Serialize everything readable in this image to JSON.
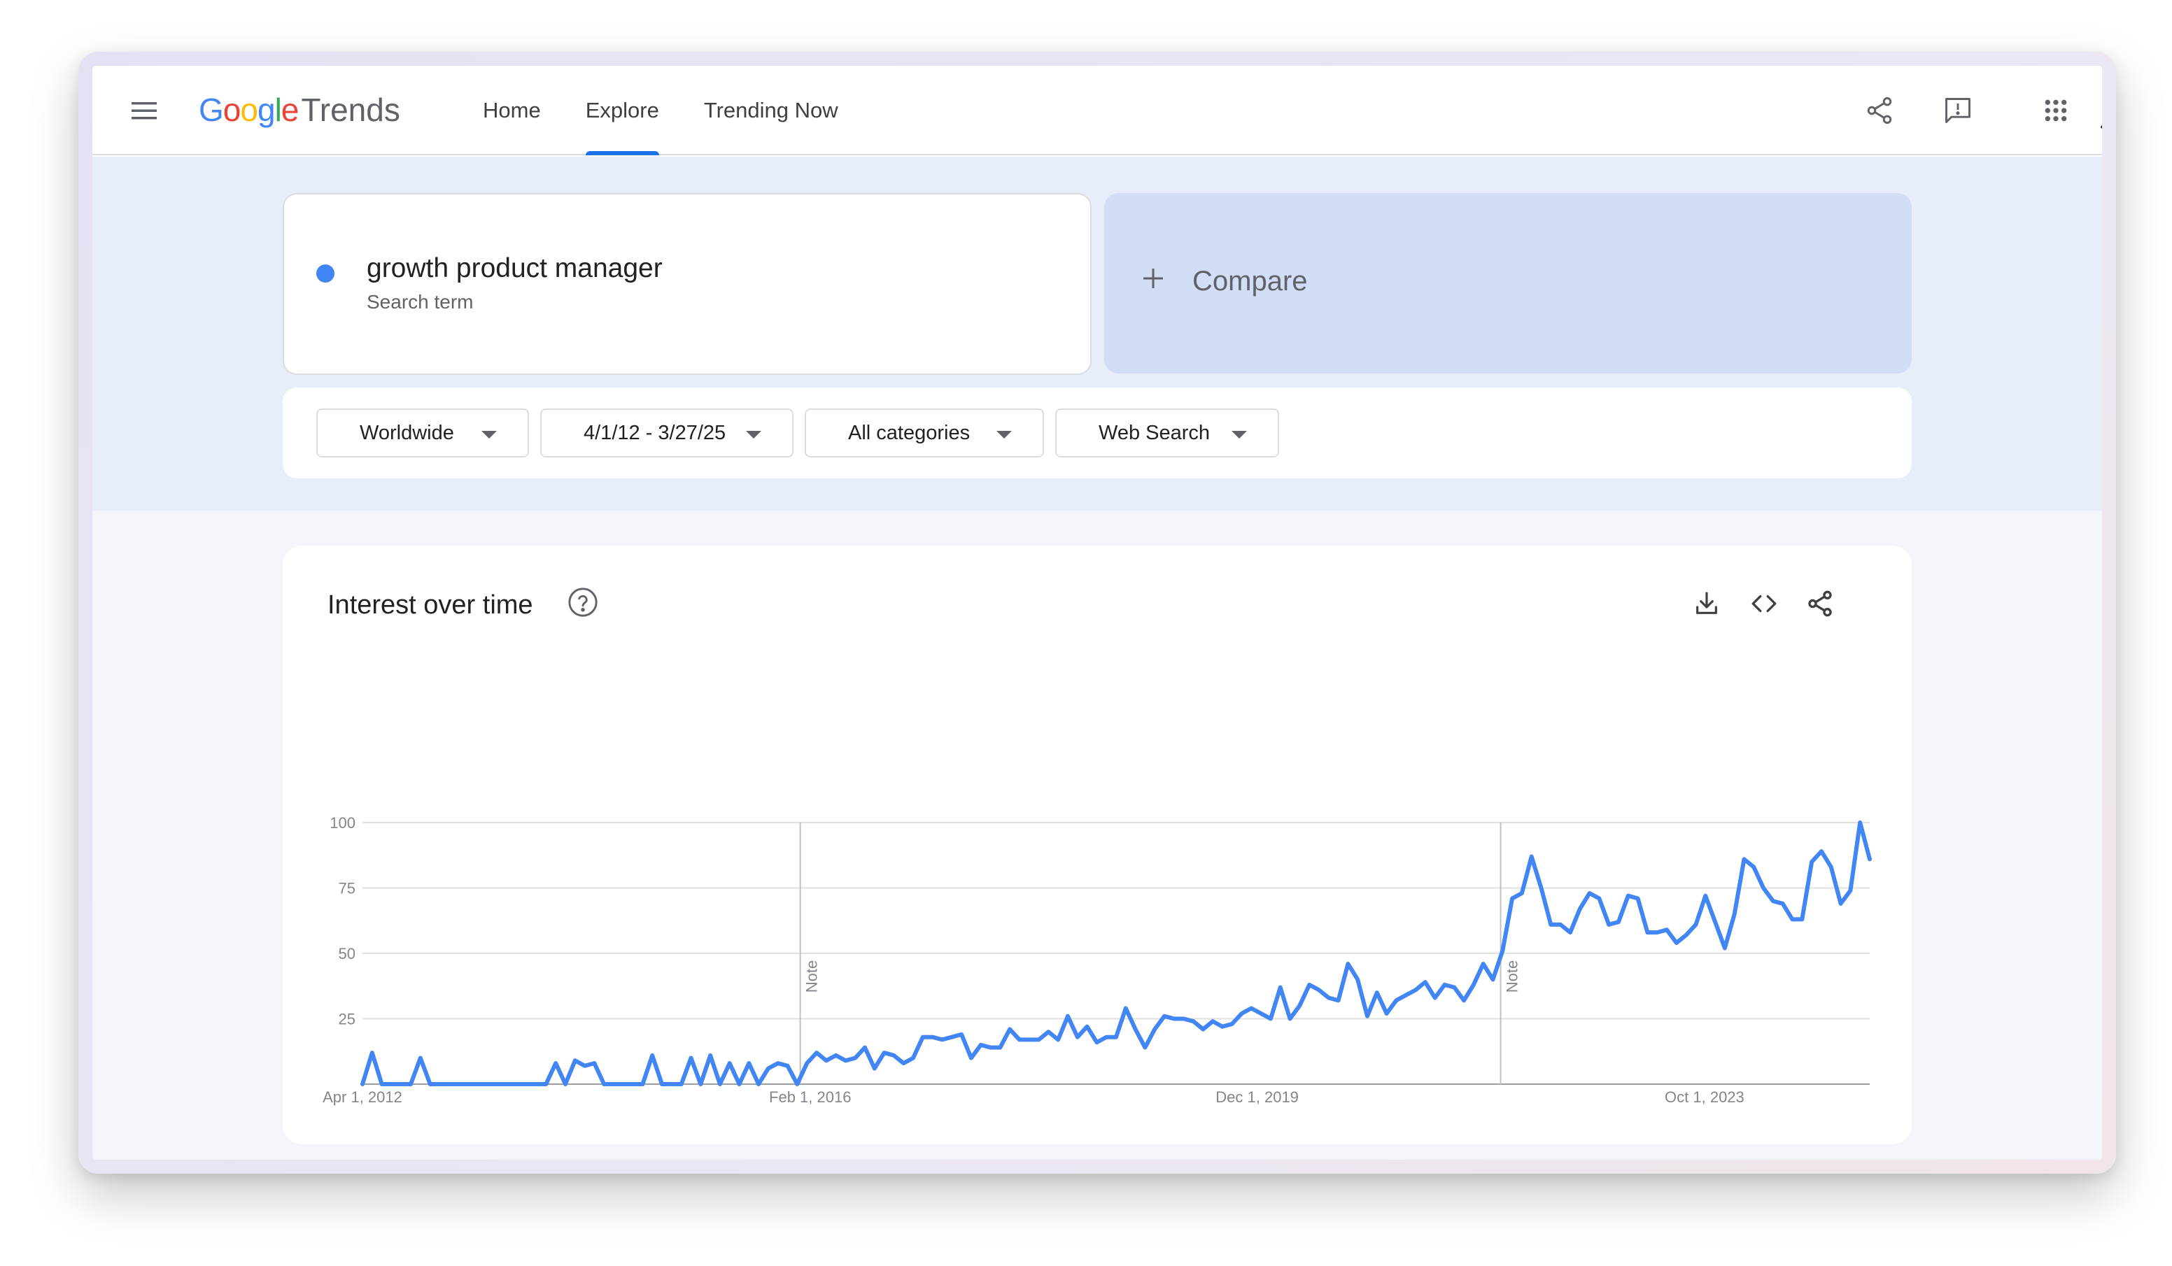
{
  "header": {
    "logo_google": "Google",
    "logo_trends": "Trends",
    "nav": [
      {
        "label": "Home",
        "active": false
      },
      {
        "label": "Explore",
        "active": true
      },
      {
        "label": "Trending Now",
        "active": false
      }
    ],
    "icons": [
      "menu-icon",
      "share-icon",
      "feedback-icon",
      "apps-grid-icon",
      "avatar"
    ]
  },
  "search": {
    "term": "growth product manager",
    "term_type": "Search term",
    "term_color": "#4285f4",
    "compare_label": "Compare"
  },
  "filters": {
    "region": "Worldwide",
    "date_range": "4/1/12 - 3/27/25",
    "category": "All categories",
    "search_type": "Web Search"
  },
  "interest": {
    "title": "Interest over time",
    "tools": [
      "download-icon",
      "embed-code-icon",
      "share-icon"
    ]
  },
  "colors": {
    "accent": "#1a73e8",
    "series": "#4285f4",
    "compare_bg": "#d2def6",
    "band_bg": "#e8eef9"
  },
  "chart_data": {
    "type": "line",
    "ylim": [
      0,
      100
    ],
    "y_ticks": [
      25,
      50,
      75,
      100
    ],
    "x_start": "Apr 1, 2012",
    "x_end": "Mar 1, 2025",
    "x_tick_labels": [
      {
        "label": "Apr 1, 2012",
        "date": "2012-04-01"
      },
      {
        "label": "Feb 1, 2016",
        "date": "2016-02-01"
      },
      {
        "label": "Dec 1, 2019",
        "date": "2019-12-01"
      },
      {
        "label": "Oct 1, 2023",
        "date": "2023-10-01"
      }
    ],
    "notes": [
      {
        "label": "Note",
        "date": "2016-01-01"
      },
      {
        "label": "Note",
        "date": "2022-01-01"
      }
    ],
    "grid": true,
    "series": [
      {
        "frequency": "monthly",
        "values": [
          0,
          12,
          0,
          0,
          0,
          0,
          10,
          0,
          0,
          0,
          0,
          0,
          0,
          0,
          0,
          0,
          0,
          0,
          0,
          0,
          8,
          0,
          9,
          7,
          8,
          0,
          0,
          0,
          0,
          0,
          11,
          0,
          0,
          0,
          10,
          0,
          11,
          0,
          8,
          0,
          8,
          0,
          6,
          8,
          7,
          0,
          8,
          12,
          9,
          11,
          9,
          10,
          14,
          6,
          12,
          11,
          8,
          10,
          18,
          18,
          17,
          18,
          19,
          10,
          15,
          14,
          14,
          21,
          17,
          17,
          17,
          20,
          17,
          26,
          18,
          22,
          16,
          18,
          18,
          29,
          21,
          14,
          21,
          26,
          25,
          25,
          24,
          21,
          24,
          22,
          23,
          27,
          29,
          27,
          25,
          37,
          25,
          30,
          38,
          36,
          33,
          32,
          46,
          40,
          26,
          35,
          27,
          32,
          34,
          36,
          39,
          33,
          38,
          37,
          32,
          38,
          46,
          40,
          51,
          71,
          73,
          87,
          75,
          61,
          61,
          58,
          67,
          73,
          71,
          61,
          62,
          72,
          71,
          58,
          58,
          59,
          54,
          57,
          61,
          72,
          62,
          52,
          65,
          86,
          83,
          75,
          70,
          69,
          63,
          63,
          85,
          89,
          83,
          69,
          74,
          100,
          86
        ]
      }
    ]
  }
}
